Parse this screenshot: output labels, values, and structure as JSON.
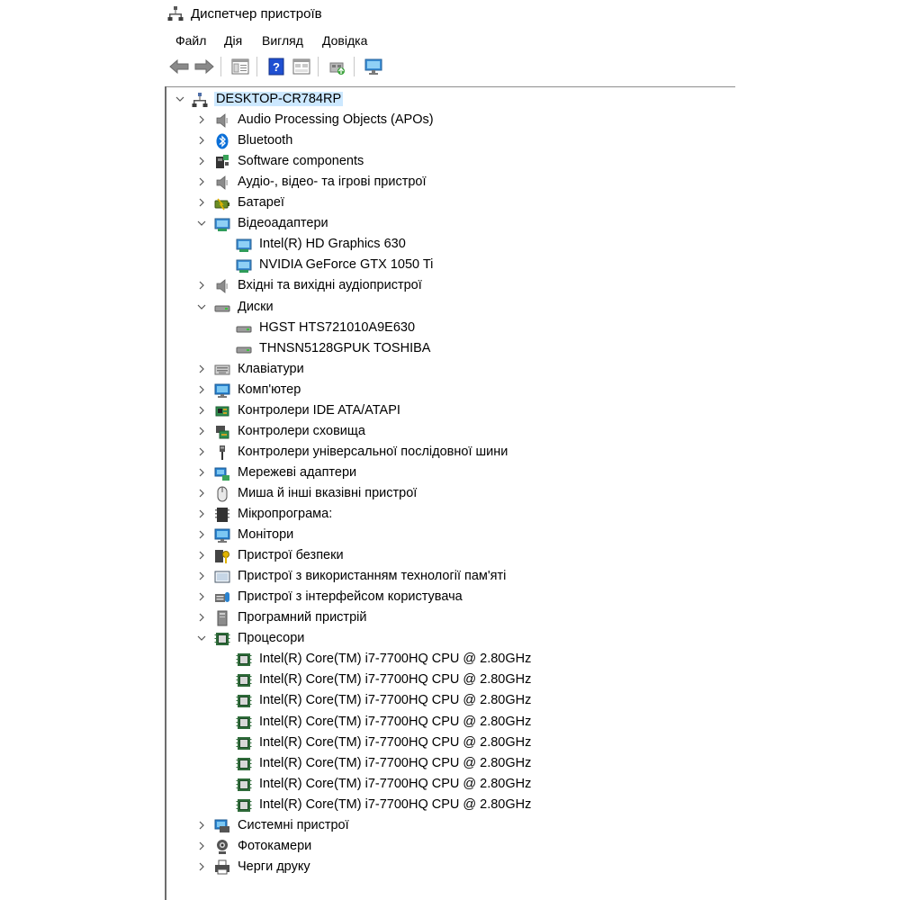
{
  "window": {
    "title": "Диспетчер пристроїв"
  },
  "menu": [
    "Файл",
    "Дія",
    "Вигляд",
    "Довідка"
  ],
  "toolbar": [
    {
      "name": "back-button",
      "icon": "arrow-left-icon"
    },
    {
      "name": "forward-button",
      "icon": "arrow-right-icon"
    },
    {
      "name": "show-hide-console-tree-button",
      "icon": "console-tree-icon"
    },
    {
      "name": "help-button",
      "icon": "help-icon"
    },
    {
      "name": "properties-view-button",
      "icon": "properties-icon"
    },
    {
      "name": "update-driver-button",
      "icon": "update-driver-icon"
    },
    {
      "name": "scan-hardware-button",
      "icon": "monitor-scan-icon"
    }
  ],
  "tree": {
    "root": {
      "label": "DESKTOP-CR784RP",
      "icon": "computer-network-icon",
      "expanded": true,
      "selected": true
    },
    "categories": [
      {
        "label": "Audio Processing Objects (APOs)",
        "icon": "speaker-icon",
        "expanded": false,
        "children": []
      },
      {
        "label": "Bluetooth",
        "icon": "bluetooth-icon",
        "expanded": false,
        "children": []
      },
      {
        "label": "Software components",
        "icon": "software-component-icon",
        "expanded": false,
        "children": []
      },
      {
        "label": "Аудіо-, відео- та ігрові пристрої",
        "icon": "speaker-icon",
        "expanded": false,
        "children": []
      },
      {
        "label": "Батареї",
        "icon": "battery-icon",
        "expanded": false,
        "children": []
      },
      {
        "label": "Відеоадаптери",
        "icon": "display-adapter-icon",
        "expanded": true,
        "children": [
          {
            "label": "Intel(R) HD Graphics 630",
            "icon": "display-adapter-icon"
          },
          {
            "label": "NVIDIA GeForce GTX 1050 Ti",
            "icon": "display-adapter-icon"
          }
        ]
      },
      {
        "label": "Вхідні та вихідні аудіопристрої",
        "icon": "speaker-icon",
        "expanded": false,
        "children": []
      },
      {
        "label": "Диски",
        "icon": "disk-drive-icon",
        "expanded": true,
        "children": [
          {
            "label": "HGST HTS721010A9E630",
            "icon": "disk-drive-icon"
          },
          {
            "label": "THNSN5128GPUK TOSHIBA",
            "icon": "disk-drive-icon"
          }
        ]
      },
      {
        "label": "Клавіатури",
        "icon": "keyboard-icon",
        "expanded": false,
        "children": []
      },
      {
        "label": "Комп'ютер",
        "icon": "monitor-icon",
        "expanded": false,
        "children": []
      },
      {
        "label": "Контролери IDE ATA/ATAPI",
        "icon": "ide-controller-icon",
        "expanded": false,
        "children": []
      },
      {
        "label": "Контролери сховища",
        "icon": "storage-controller-icon",
        "expanded": false,
        "children": []
      },
      {
        "label": "Контролери універсальної послідовної шини",
        "icon": "usb-icon",
        "expanded": false,
        "children": []
      },
      {
        "label": "Мережеві адаптери",
        "icon": "network-adapter-icon",
        "expanded": false,
        "children": []
      },
      {
        "label": "Миша й інші вказівні пристрої",
        "icon": "mouse-icon",
        "expanded": false,
        "children": []
      },
      {
        "label": "Мікропрограма:",
        "icon": "firmware-icon",
        "expanded": false,
        "children": []
      },
      {
        "label": "Монітори",
        "icon": "monitor-icon",
        "expanded": false,
        "children": []
      },
      {
        "label": "Пристрої безпеки",
        "icon": "security-device-icon",
        "expanded": false,
        "children": []
      },
      {
        "label": "Пристрої з використанням технології пам'яті",
        "icon": "memory-device-icon",
        "expanded": false,
        "children": []
      },
      {
        "label": "Пристрої з інтерфейсом користувача",
        "icon": "hid-icon",
        "expanded": false,
        "children": []
      },
      {
        "label": "Програмний пристрій",
        "icon": "software-device-icon",
        "expanded": false,
        "children": []
      },
      {
        "label": "Процесори",
        "icon": "processor-icon",
        "expanded": true,
        "children": [
          {
            "label": "Intel(R) Core(TM) i7-7700HQ CPU @ 2.80GHz",
            "icon": "processor-icon"
          },
          {
            "label": "Intel(R) Core(TM) i7-7700HQ CPU @ 2.80GHz",
            "icon": "processor-icon"
          },
          {
            "label": "Intel(R) Core(TM) i7-7700HQ CPU @ 2.80GHz",
            "icon": "processor-icon"
          },
          {
            "label": "Intel(R) Core(TM) i7-7700HQ CPU @ 2.80GHz",
            "icon": "processor-icon"
          },
          {
            "label": "Intel(R) Core(TM) i7-7700HQ CPU @ 2.80GHz",
            "icon": "processor-icon"
          },
          {
            "label": "Intel(R) Core(TM) i7-7700HQ CPU @ 2.80GHz",
            "icon": "processor-icon"
          },
          {
            "label": "Intel(R) Core(TM) i7-7700HQ CPU @ 2.80GHz",
            "icon": "processor-icon"
          },
          {
            "label": "Intel(R) Core(TM) i7-7700HQ CPU @ 2.80GHz",
            "icon": "processor-icon"
          }
        ]
      },
      {
        "label": "Системні пристрої",
        "icon": "system-device-icon",
        "expanded": false,
        "children": []
      },
      {
        "label": "Фотокамери",
        "icon": "camera-icon",
        "expanded": false,
        "children": []
      },
      {
        "label": "Черги друку",
        "icon": "printer-icon",
        "expanded": false,
        "children": []
      }
    ]
  },
  "colors": {
    "selection": "#cce8ff",
    "frame": "#6d6d6d",
    "chevron": "#555555"
  }
}
